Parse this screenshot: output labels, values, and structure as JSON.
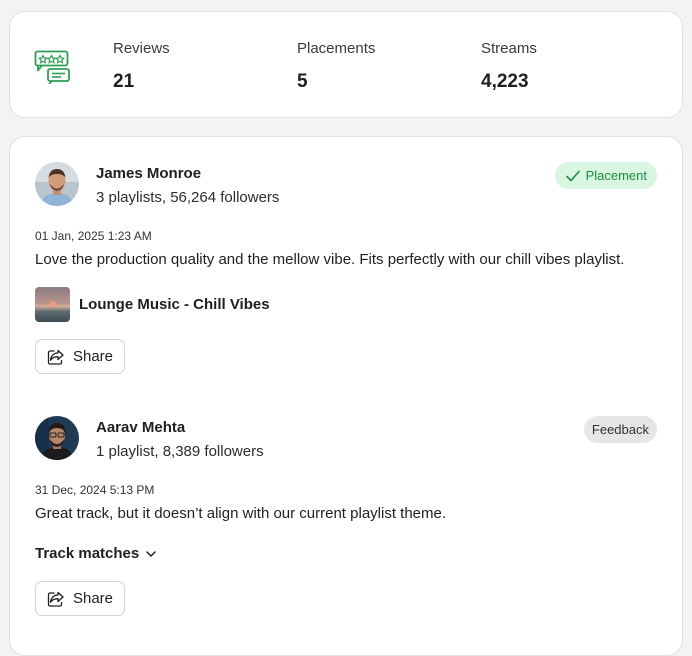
{
  "stats": {
    "icon": "reviews-chat-icon",
    "accent_color": "#2f9e55",
    "items": [
      {
        "label": "Reviews",
        "value": "21"
      },
      {
        "label": "Placements",
        "value": "5"
      },
      {
        "label": "Streams",
        "value": "4,223"
      }
    ]
  },
  "reviews": [
    {
      "name": "James Monroe",
      "meta": "3 playlists, 56,264 followers",
      "badge": "Placement",
      "badge_color": "#1b8a44",
      "date": "01 Jan, 2025 1:23 AM",
      "text": "Love the production quality and the mellow vibe. Fits perfectly with our chill vibes playlist.",
      "playlist": "Lounge Music - Chill Vibes",
      "share_label": "Share"
    },
    {
      "name": "Aarav Mehta",
      "meta": "1 playlist, 8,389 followers",
      "badge": "Feedback",
      "date": "31 Dec, 2024 5:13 PM",
      "text": "Great track, but it doesn’t align with our current playlist theme.",
      "track_matches": "Track matches",
      "share_label": "Share"
    }
  ]
}
